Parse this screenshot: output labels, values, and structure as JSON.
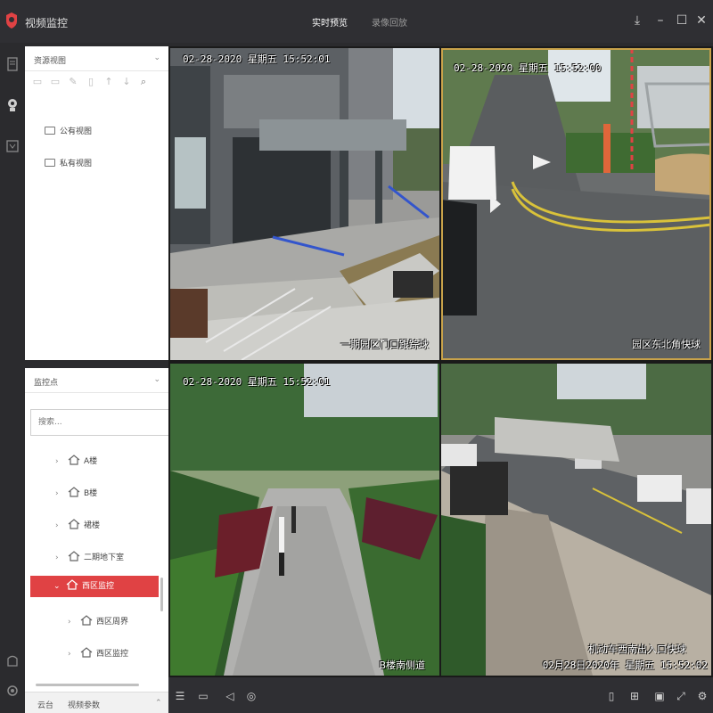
{
  "app": {
    "title": "视频监控"
  },
  "tabs": [
    {
      "label": "实时预览",
      "active": true
    },
    {
      "label": "录像回放",
      "active": false
    }
  ],
  "resource_view": {
    "header": "资源视图",
    "folders": [
      {
        "label": "公有视图"
      },
      {
        "label": "私有视图"
      }
    ]
  },
  "monitor_points": {
    "header": "监控点",
    "search_placeholder": "搜索...",
    "tree": [
      {
        "label": "A楼",
        "selected": false
      },
      {
        "label": "B楼",
        "selected": false
      },
      {
        "label": "裙楼",
        "selected": false
      },
      {
        "label": "二期地下室",
        "selected": false
      },
      {
        "label": "西区监控",
        "selected": true
      },
      {
        "label": "西区周界",
        "selected": false
      },
      {
        "label": "西区监控",
        "selected": false
      }
    ]
  },
  "bottom_tabs": [
    {
      "label": "云台"
    },
    {
      "label": "视频参数"
    }
  ],
  "cameras": [
    {
      "timestamp": "02-28-2020 星期五 15:52:01",
      "name": "一期园区门口跟踪球"
    },
    {
      "timestamp": "02-28-2020 星期五 15:52:00",
      "name": "园区东北角快球"
    },
    {
      "timestamp": "02-28-2020 星期五 15:52:01",
      "name": "B楼南侧道"
    },
    {
      "timestamp": "02月28日2020年 星期五 15:52:02",
      "name": "机动车西南出入口快球"
    }
  ],
  "colors": {
    "accent": "#e04244",
    "titlebar": "#2f2f33",
    "selected_border": "#c8a24a"
  }
}
